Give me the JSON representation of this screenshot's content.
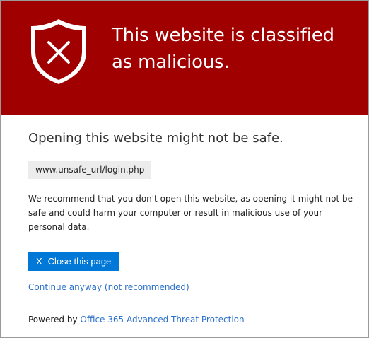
{
  "banner": {
    "title": "This website is classified as malicious.",
    "icon": "shield-x-icon",
    "color": "#a00000"
  },
  "main": {
    "subtitle": "Opening this website might not be safe.",
    "url": "www.unsafe_url/login.php",
    "recommendation": "We recommend that you don't open this website, as opening it might not be safe and could harm your computer or result in malicious use of your personal data.",
    "close_button_icon": "X",
    "close_button_label": "Close this page",
    "continue_link": "Continue anyway (not recommended)"
  },
  "footer": {
    "powered_by_label": "Powered by",
    "powered_by_link": "Office 365 Advanced Threat Protection"
  },
  "colors": {
    "accent": "#0078d7",
    "link": "#2b70c9"
  }
}
